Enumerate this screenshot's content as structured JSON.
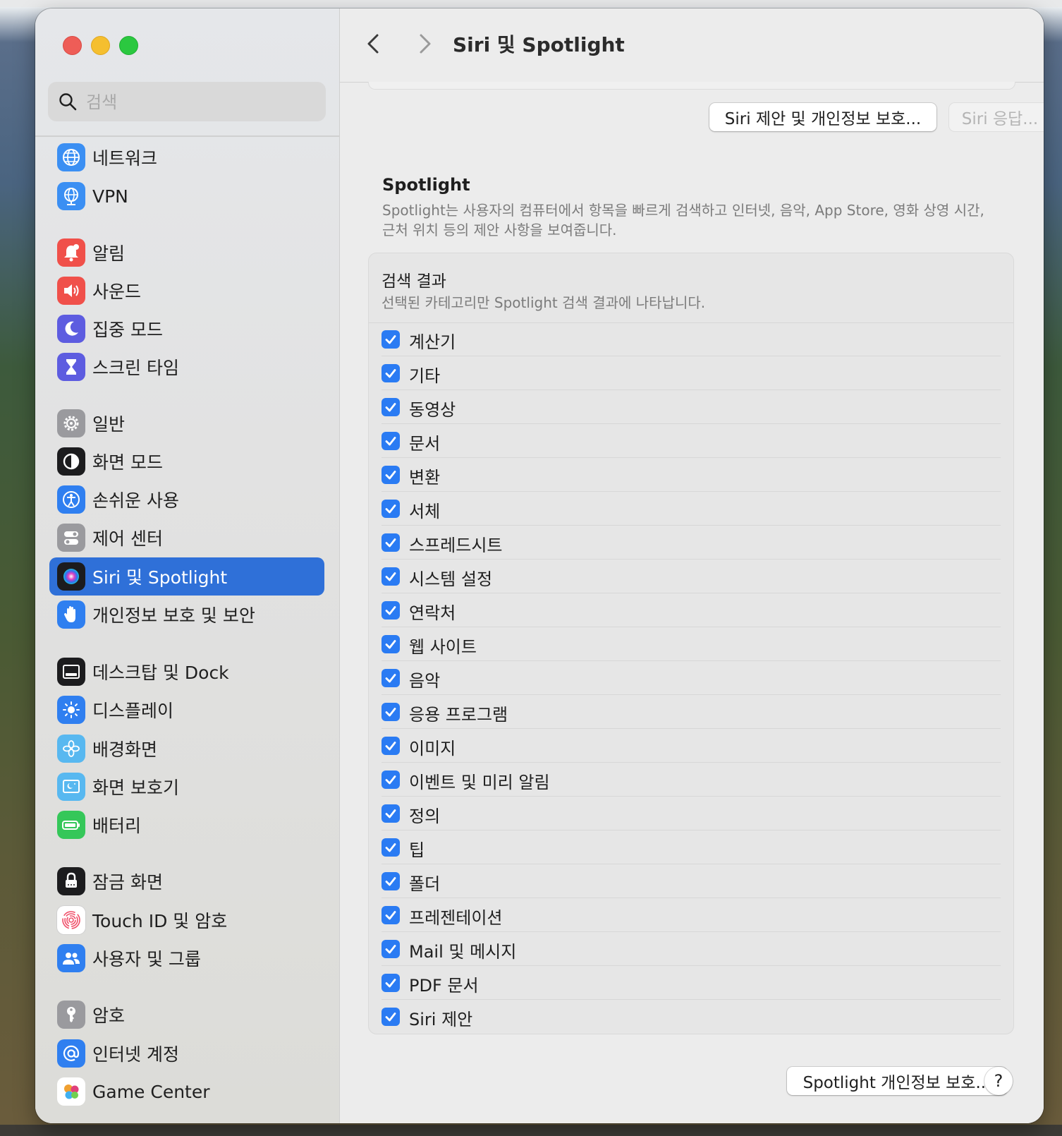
{
  "window": {
    "title": "Siri 및 Spotlight"
  },
  "search": {
    "placeholder": "검색"
  },
  "sidebar": {
    "items": [
      {
        "label": "네트워크",
        "icon": "globe-icon",
        "color": "#3b8ff3"
      },
      {
        "label": "VPN",
        "icon": "vpn-globe-icon",
        "color": "#3b8ff3"
      },
      {
        "label": "알림",
        "icon": "bell-icon",
        "color": "#f0504a"
      },
      {
        "label": "사운드",
        "icon": "speaker-icon",
        "color": "#f0504a"
      },
      {
        "label": "집중 모드",
        "icon": "moon-icon",
        "color": "#5d5ce0"
      },
      {
        "label": "스크린 타임",
        "icon": "hourglass-icon",
        "color": "#5d5ce0"
      },
      {
        "label": "일반",
        "icon": "gear-icon",
        "color": "#9a9a9e"
      },
      {
        "label": "화면 모드",
        "icon": "appearance-icon",
        "color": "#1c1c1e"
      },
      {
        "label": "손쉬운 사용",
        "icon": "accessibility-icon",
        "color": "#2f7ff0"
      },
      {
        "label": "제어 센터",
        "icon": "toggles-icon",
        "color": "#9a9a9e"
      },
      {
        "label": "Siri 및 Spotlight",
        "icon": "siri-icon",
        "color": "#1c1c1e"
      },
      {
        "label": "개인정보 보호 및 보안",
        "icon": "hand-icon",
        "color": "#2f7ff0"
      },
      {
        "label": "데스크탑 및 Dock",
        "icon": "dock-icon",
        "color": "#1c1c1e"
      },
      {
        "label": "디스플레이",
        "icon": "sun-icon",
        "color": "#2f7ff0"
      },
      {
        "label": "배경화면",
        "icon": "flower-icon",
        "color": "#58b8f0"
      },
      {
        "label": "화면 보호기",
        "icon": "screensaver-icon",
        "color": "#58b8f0"
      },
      {
        "label": "배터리",
        "icon": "battery-icon",
        "color": "#35c759"
      },
      {
        "label": "잠금 화면",
        "icon": "lock-icon",
        "color": "#1c1c1e"
      },
      {
        "label": "Touch ID 및 암호",
        "icon": "fingerprint-icon",
        "color": "#ffffff"
      },
      {
        "label": "사용자 및 그룹",
        "icon": "users-icon",
        "color": "#2f7ff0"
      },
      {
        "label": "암호",
        "icon": "key-icon",
        "color": "#9a9a9e"
      },
      {
        "label": "인터넷 계정",
        "icon": "at-icon",
        "color": "#2f7ff0"
      },
      {
        "label": "Game Center",
        "icon": "game-center-icon",
        "color": "#ffffff"
      }
    ]
  },
  "buttons": {
    "siri_privacy": "Siri 제안 및 개인정보 보호...",
    "siri_responses": "Siri 응답...",
    "spotlight_privacy": "Spotlight 개인정보 보호...",
    "help": "?"
  },
  "spotlight": {
    "title": "Spotlight",
    "description": "Spotlight는 사용자의 컴퓨터에서 항목을 빠르게 검색하고 인터넷, 음악, App Store, 영화 상영 시간, 근처 위치 등의 제안 사항을 보여줍니다."
  },
  "results": {
    "title": "검색 결과",
    "subtitle": "선택된 카테고리만 Spotlight 검색 결과에 나타납니다.",
    "categories": [
      {
        "label": "계산기",
        "checked": true
      },
      {
        "label": "기타",
        "checked": true
      },
      {
        "label": "동영상",
        "checked": true
      },
      {
        "label": "문서",
        "checked": true
      },
      {
        "label": "변환",
        "checked": true
      },
      {
        "label": "서체",
        "checked": true
      },
      {
        "label": "스프레드시트",
        "checked": true
      },
      {
        "label": "시스템 설정",
        "checked": true
      },
      {
        "label": "연락처",
        "checked": true
      },
      {
        "label": "웹 사이트",
        "checked": true
      },
      {
        "label": "음악",
        "checked": true
      },
      {
        "label": "응용 프로그램",
        "checked": true
      },
      {
        "label": "이미지",
        "checked": true
      },
      {
        "label": "이벤트 및 미리 알림",
        "checked": true
      },
      {
        "label": "정의",
        "checked": true
      },
      {
        "label": "팁",
        "checked": true
      },
      {
        "label": "폴더",
        "checked": true
      },
      {
        "label": "프레젠테이션",
        "checked": true
      },
      {
        "label": "Mail 및 메시지",
        "checked": true
      },
      {
        "label": "PDF 문서",
        "checked": true
      },
      {
        "label": "Siri 제안",
        "checked": true
      }
    ]
  },
  "colors": {
    "accent": "#2a7bf3",
    "selection": "#2f70d8"
  }
}
